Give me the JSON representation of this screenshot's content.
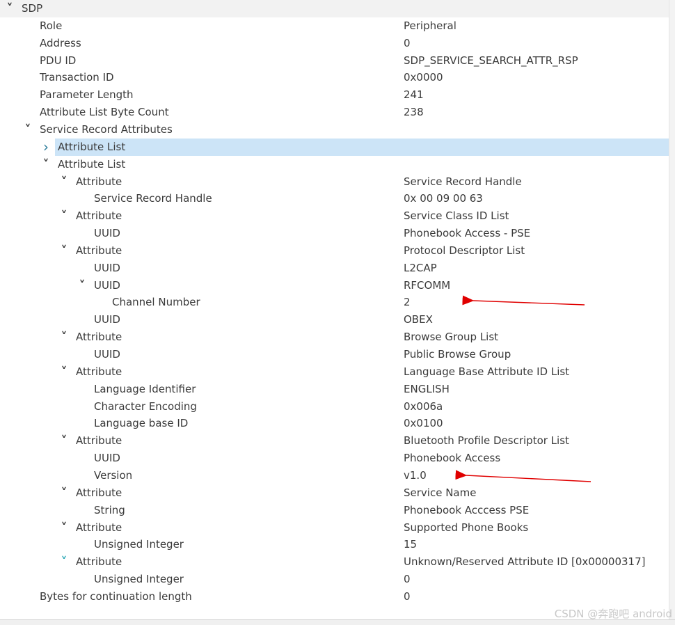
{
  "rows": [
    {
      "label": "SDP",
      "value": "",
      "indent": 0,
      "expander": "down",
      "style": "head"
    },
    {
      "label": "Role",
      "value": "Peripheral",
      "indent": 2
    },
    {
      "label": "Address",
      "value": "0",
      "indent": 2
    },
    {
      "label": "PDU ID",
      "value": "SDP_SERVICE_SEARCH_ATTR_RSP",
      "indent": 2
    },
    {
      "label": "Transaction ID",
      "value": "0x0000",
      "indent": 2
    },
    {
      "label": "Parameter Length",
      "value": "241",
      "indent": 2
    },
    {
      "label": "Attribute List Byte Count",
      "value": "238",
      "indent": 2
    },
    {
      "label": "Service Record Attributes",
      "value": "",
      "indent": 2,
      "expander": "down"
    },
    {
      "label": "Attribute List",
      "value": "",
      "indent": 3,
      "expander": "right",
      "selected": true
    },
    {
      "label": "Attribute List",
      "value": "",
      "indent": 3,
      "expander": "down"
    },
    {
      "label": "Attribute",
      "value": "Service Record Handle",
      "indent": 4,
      "expander": "down"
    },
    {
      "label": "Service Record Handle",
      "value": "0x 00 09 00 63",
      "indent": 5
    },
    {
      "label": "Attribute",
      "value": "Service Class ID List",
      "indent": 4,
      "expander": "down"
    },
    {
      "label": "UUID",
      "value": "Phonebook Access - PSE",
      "indent": 5
    },
    {
      "label": "Attribute",
      "value": "Protocol Descriptor List",
      "indent": 4,
      "expander": "down"
    },
    {
      "label": "UUID",
      "value": "L2CAP",
      "indent": 5
    },
    {
      "label": "UUID",
      "value": "RFCOMM",
      "indent": 5,
      "expander": "down"
    },
    {
      "label": "Channel Number",
      "value": "2",
      "indent": 6
    },
    {
      "label": "UUID",
      "value": "OBEX",
      "indent": 5
    },
    {
      "label": "Attribute",
      "value": "Browse Group List",
      "indent": 4,
      "expander": "down"
    },
    {
      "label": "UUID",
      "value": "Public Browse Group",
      "indent": 5
    },
    {
      "label": "Attribute",
      "value": "Language Base Attribute ID List",
      "indent": 4,
      "expander": "down"
    },
    {
      "label": "Language Identifier",
      "value": "ENGLISH",
      "indent": 5
    },
    {
      "label": "Character Encoding",
      "value": "0x006a",
      "indent": 5
    },
    {
      "label": "Language base ID",
      "value": "0x0100",
      "indent": 5
    },
    {
      "label": "Attribute",
      "value": "Bluetooth Profile Descriptor List",
      "indent": 4,
      "expander": "down"
    },
    {
      "label": "UUID",
      "value": "Phonebook Access",
      "indent": 5
    },
    {
      "label": "Version",
      "value": "v1.0",
      "indent": 5
    },
    {
      "label": "Attribute",
      "value": "Service Name",
      "indent": 4,
      "expander": "down"
    },
    {
      "label": "String",
      "value": "Phonebook Acccess PSE",
      "indent": 5
    },
    {
      "label": "Attribute",
      "value": "Supported Phone Books",
      "indent": 4,
      "expander": "down"
    },
    {
      "label": "Unsigned Integer",
      "value": "15",
      "indent": 5
    },
    {
      "label": "Attribute",
      "value": "Unknown/Reserved Attribute ID [0x00000317]",
      "indent": 4,
      "expander": "teal"
    },
    {
      "label": "Unsigned Integer",
      "value": "0",
      "indent": 5
    },
    {
      "label": "Bytes for continuation length",
      "value": "0",
      "indent": 2
    }
  ],
  "watermark": "CSDN @奔跑吧 android",
  "colors": {
    "selection": "#cce4f7",
    "arrow": "#e00000"
  }
}
